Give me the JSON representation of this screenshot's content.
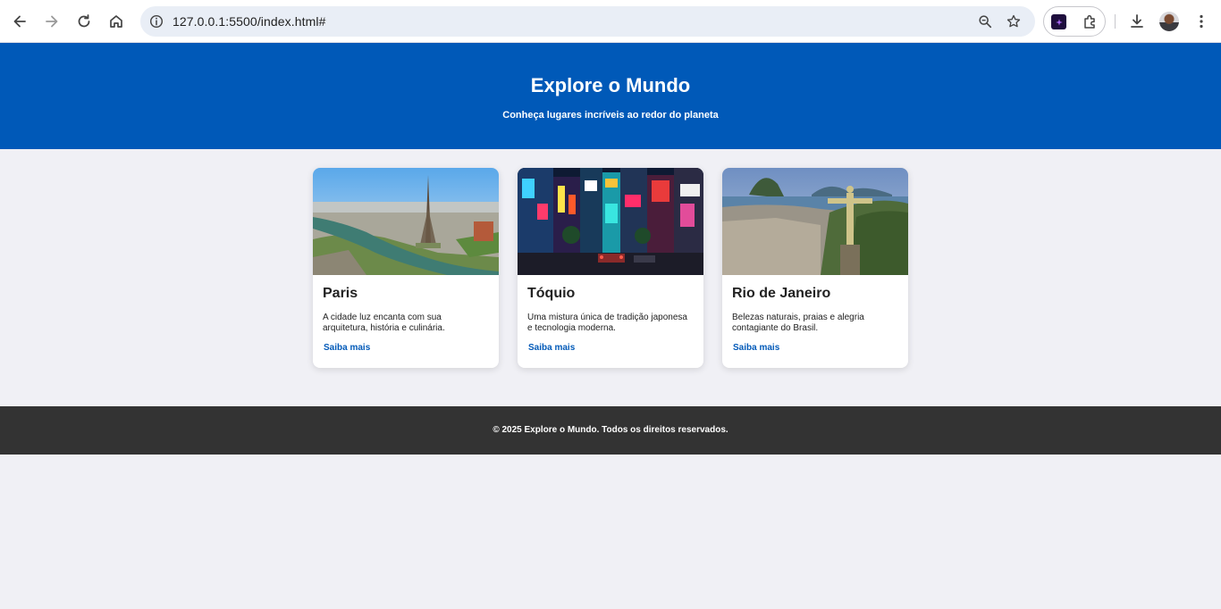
{
  "browser": {
    "url": "127.0.0.1:5500/index.html#"
  },
  "header": {
    "title": "Explore o Mundo",
    "subtitle": "Conheça lugares incríveis ao redor do planeta"
  },
  "cards": [
    {
      "title": "Paris",
      "text": "A cidade luz encanta com sua arquitetura, história e culinária.",
      "link": "Saiba mais"
    },
    {
      "title": "Tóquio",
      "text": "Uma mistura única de tradição japonesa e tecnologia moderna.",
      "link": "Saiba mais"
    },
    {
      "title": "Rio de Janeiro",
      "text": "Belezas naturais, praias e alegria contagiante do Brasil.",
      "link": "Saiba mais"
    }
  ],
  "footer": {
    "text": "© 2025 Explore o Mundo. Todos os direitos reservados."
  },
  "colors": {
    "header_bg": "#0059b8",
    "footer_bg": "#333333",
    "link": "#0059b8",
    "page_bg": "#f0f0f5"
  }
}
